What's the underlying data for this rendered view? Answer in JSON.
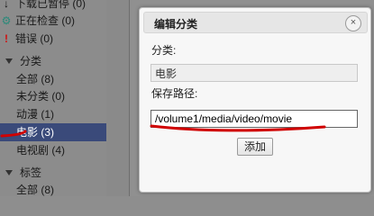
{
  "sidebar": {
    "status_items": [
      {
        "icon": "download-paused-icon",
        "glyph": "↓",
        "label": "下载已暂停 (0)",
        "color": "#111111"
      },
      {
        "icon": "checking-gear-icon",
        "glyph": "⚙",
        "label": "正在检查 (0)",
        "color": "#2a8a7a"
      },
      {
        "icon": "error-icon",
        "glyph": "!",
        "label": "错误 (0)",
        "color": "#d01010"
      }
    ],
    "categories_header": "分类",
    "categories": [
      {
        "label": "全部 (8)"
      },
      {
        "label": "未分类 (0)"
      },
      {
        "label": "动漫 (1)"
      },
      {
        "label": "电影 (3)",
        "selected": true
      },
      {
        "label": "电视剧 (4)"
      }
    ],
    "tags_header": "标签",
    "tags": [
      {
        "label": "全部 (8)"
      }
    ]
  },
  "dialog": {
    "title": "编辑分类",
    "close_glyph": "×",
    "category_label": "分类:",
    "category_value": "电影",
    "path_label": "保存路径:",
    "path_value": "/volume1/media/video/movie",
    "add_button": "添加"
  },
  "colors": {
    "selected_bg": "#3a4a7a",
    "annotation_red": "#d00000"
  }
}
